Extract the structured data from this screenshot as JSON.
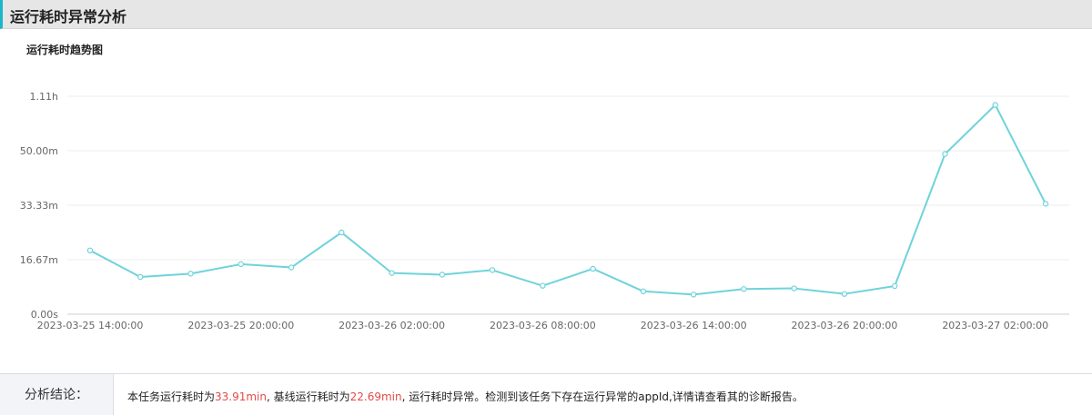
{
  "header": {
    "title": "运行耗时异常分析"
  },
  "chart_data": {
    "type": "line",
    "title": "运行耗时趋势图",
    "xlabel": "",
    "ylabel": "",
    "y_ticks": [
      {
        "value": 0,
        "label": "0.00s"
      },
      {
        "value": 16.67,
        "label": "16.67m"
      },
      {
        "value": 33.33,
        "label": "33.33m"
      },
      {
        "value": 50.0,
        "label": "50.00m"
      },
      {
        "value": 66.67,
        "label": "1.11h"
      }
    ],
    "ylim": [
      0,
      66.67
    ],
    "x_tick_labels": [
      "2023-03-25 14:00:00",
      "2023-03-25 20:00:00",
      "2023-03-26 02:00:00",
      "2023-03-26 08:00:00",
      "2023-03-26 14:00:00",
      "2023-03-26 20:00:00",
      "2023-03-27 02:00:00"
    ],
    "x_tick_every": 3,
    "grid": true,
    "color": "#6fd3db",
    "series": [
      {
        "x": [
          "2023-03-25 14:00:00",
          "2023-03-25 16:00:00",
          "2023-03-25 18:00:00",
          "2023-03-25 20:00:00",
          "2023-03-25 22:00:00",
          "2023-03-26 00:00:00",
          "2023-03-26 02:00:00",
          "2023-03-26 04:00:00",
          "2023-03-26 06:00:00",
          "2023-03-26 08:00:00",
          "2023-03-26 10:00:00",
          "2023-03-26 12:00:00",
          "2023-03-26 14:00:00",
          "2023-03-26 16:00:00",
          "2023-03-26 18:00:00",
          "2023-03-26 20:00:00",
          "2023-03-26 22:00:00",
          "2023-03-27 00:00:00",
          "2023-03-27 02:00:00",
          "2023-03-27 04:00:00"
        ],
        "values": [
          19.5,
          11.4,
          12.4,
          15.3,
          14.3,
          25.0,
          12.6,
          12.1,
          13.5,
          8.7,
          13.9,
          7.0,
          6.0,
          7.7,
          7.9,
          6.2,
          8.6,
          49.0,
          64.0,
          33.8
        ]
      }
    ]
  },
  "footer": {
    "label": "分析结论：",
    "text_part1": "本任务运行耗时为",
    "value1": "33.91min",
    "text_part2": ", 基线运行耗时为",
    "value2": "22.69min",
    "text_part3": ", 运行耗时异常。检测到该任务下存在运行异常的appId,详情请查看其的诊断报告。"
  }
}
